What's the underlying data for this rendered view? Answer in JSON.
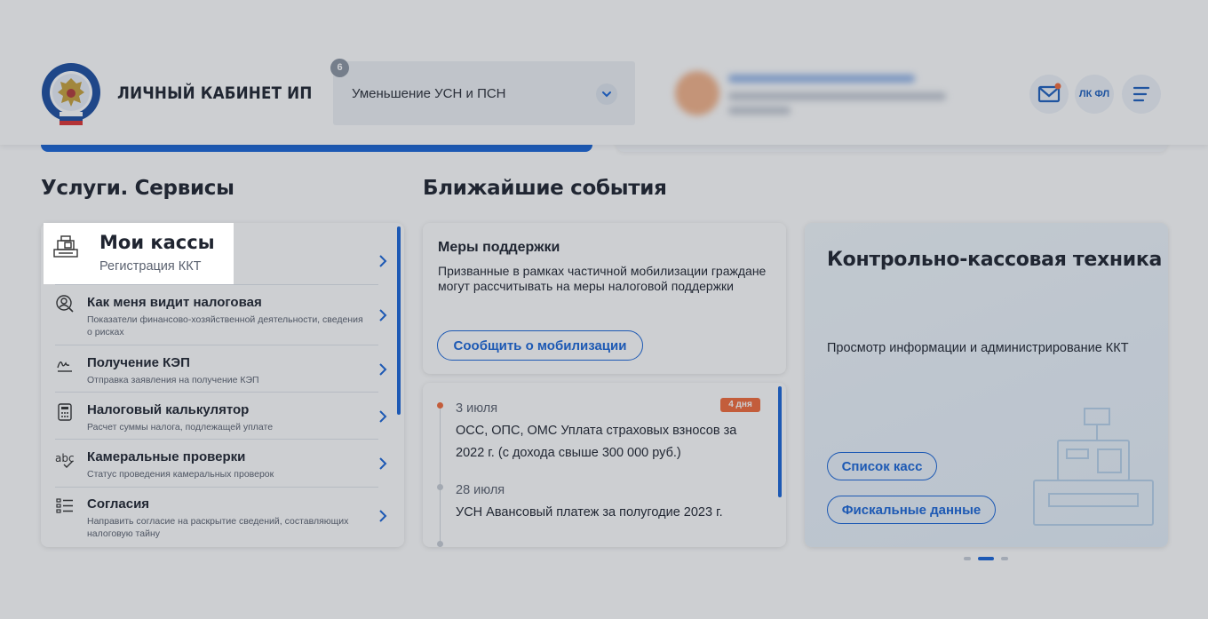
{
  "header": {
    "brand": "ЛИЧНЫЙ КАБИНЕТ ИП",
    "mode_badge": "6",
    "mode_select": "Уменьшение УСН и ПСН",
    "lkfl_label": "ЛК ФЛ",
    "colors": {
      "accent": "#1a66d8",
      "notify_dot": "#f26b3b"
    }
  },
  "services": {
    "heading": "Услуги. Сервисы",
    "highlight": {
      "title": "Мои кассы",
      "subtitle": "Регистрация ККТ"
    },
    "items": [
      {
        "title": "Как меня видит налоговая",
        "subtitle": "Показатели финансово-хозяйственной деятельности, сведения о рисках",
        "icon": "person-search-icon"
      },
      {
        "title": "Получение КЭП",
        "subtitle": "Отправка заявления на получение КЭП",
        "icon": "signature-icon"
      },
      {
        "title": "Налоговый калькулятор",
        "subtitle": "Расчет суммы налога, подлежащей уплате",
        "icon": "calculator-icon"
      },
      {
        "title": "Камеральные проверки",
        "subtitle": "Статус проведения камеральных проверок",
        "icon": "spellcheck-icon"
      },
      {
        "title": "Согласия",
        "subtitle": "Направить согласие на раскрытие сведений, составляющих налоговую тайну",
        "icon": "checklist-icon"
      }
    ]
  },
  "events": {
    "heading": "Ближайшие события",
    "support": {
      "title": "Меры поддержки",
      "text": "Призванные в рамках частичной мобилизации граждане могут рассчитывать на меры налоговой поддержки",
      "button": "Сообщить о мобилизации"
    },
    "list": [
      {
        "date": "3 июля",
        "text": "ОСС, ОПС, ОМС Уплата страховых взносов за 2022 г. (с дохода свыше 300 000 руб.)",
        "badge": "4 дня"
      },
      {
        "date": "28 июля",
        "text": "УСН Авансовый платеж за полугодие 2023 г."
      }
    ]
  },
  "kkt": {
    "title": "Контрольно-кассовая техника",
    "text": "Просмотр информации и администрирование ККТ",
    "buttons": [
      "Список касс",
      "Фискальные данные"
    ]
  }
}
